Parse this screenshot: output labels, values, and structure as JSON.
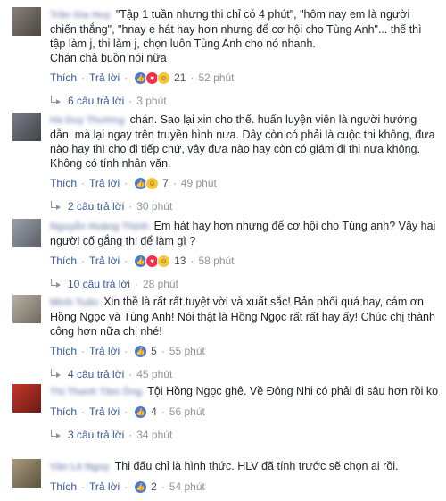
{
  "comments": [
    {
      "author": "Trần Gia Huy",
      "text": "\"Tập 1 tuần nhưng thi chỉ có 4 phút\", \"hôm nay em là người chiến thắng\", \"hnay e hát hay hơn nhưng để cơ hội cho Tùng Anh\"... thế thì tập làm j, thi làm j, chọn luôn Tùng Anh cho nó nhanh.\nChán chả buồn nói nữa",
      "like_label": "Thích",
      "reply_label": "Trả lời",
      "reactions": [
        "like",
        "love",
        "haha"
      ],
      "reaction_count": "21",
      "time": "52 phút",
      "replies_label": "6 câu trả lời",
      "replies_time": "3 phút"
    },
    {
      "author": "Hà Duy Thường",
      "text": "chán. Sao lại xin cho thế. huấn luyện viên là người hướng dẫn. mà lại ngay trên truyền hình nưa. Dây còn có phải là cuộc thi không, đưa nào hay thì cho đi tiếp chứ, vậy đưa nào hay còn có giám đi thi nưa không. Không có tính nhân văn.",
      "like_label": "Thích",
      "reply_label": "Trả lời",
      "reactions": [
        "like",
        "haha"
      ],
      "reaction_count": "7",
      "time": "49 phút",
      "replies_label": "2 câu trả lời",
      "replies_time": "30 phút"
    },
    {
      "author": "Nguyễn Hoàng Thịnh",
      "text": "Em hát hay hơn nhưng để cơ hội cho Tùng anh? Vậy hai người cố gắng thi để làm gì ?",
      "like_label": "Thích",
      "reply_label": "Trả lời",
      "reactions": [
        "like",
        "love",
        "haha"
      ],
      "reaction_count": "13",
      "time": "58 phút",
      "replies_label": "10 câu trả lời",
      "replies_time": "28 phút"
    },
    {
      "author": "Minh Tuấn",
      "text": "Xin thề là rất rất tuyệt vời và xuất sắc! Bản phối quá hay, cám ơn Hồng Ngọc và Tùng Anh! Nói thật là Hồng Ngọc rất rất hay ấy! Chúc chị thành công hơn nữa chị nhé!",
      "like_label": "Thích",
      "reply_label": "Trả lời",
      "reactions": [
        "like"
      ],
      "reaction_count": "5",
      "time": "55 phút",
      "replies_label": "4 câu trả lời",
      "replies_time": "45 phút"
    },
    {
      "author": "Thị Thanh Tâm Ông",
      "text": "Tội Hồng Ngọc ghê. Về Đông Nhi có phải đi sâu hơn rồi ko",
      "like_label": "Thích",
      "reply_label": "Trả lời",
      "reactions": [
        "like"
      ],
      "reaction_count": "4",
      "time": "56 phút",
      "replies_label": "3 câu trả lời",
      "replies_time": "34 phút"
    },
    {
      "author": "Văn Lê Nguy",
      "text": "Thi đấu chỉ là hình thức. HLV đã tính trước sẽ chọn ai rồi.",
      "like_label": "Thích",
      "reply_label": "Trả lời",
      "reactions": [
        "like"
      ],
      "reaction_count": "2",
      "time": "54 phút",
      "replies_label": "",
      "replies_time": ""
    }
  ],
  "colors": {
    "link": "#365899",
    "muted": "#90949c",
    "like_blue": "#4a78d6",
    "love_red": "#f0304c",
    "haha_yellow": "#f7c53b"
  },
  "icons": {
    "like": "thumbs-up-icon",
    "love": "heart-icon",
    "haha": "laughing-face-icon",
    "reply": "reply-arrow-icon"
  }
}
